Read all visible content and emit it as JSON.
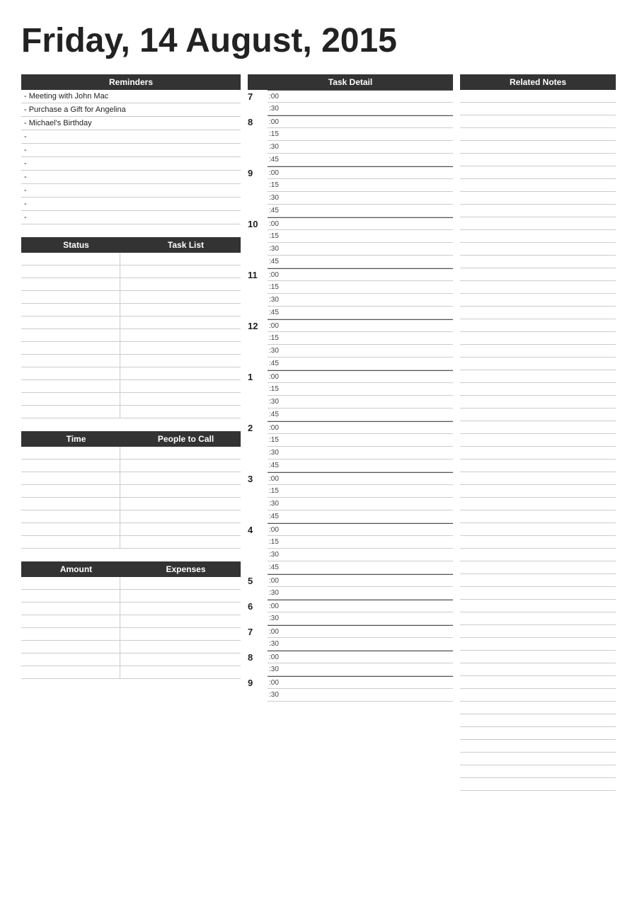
{
  "title": "Friday, 14 August, 2015",
  "reminders": {
    "header": "Reminders",
    "items": [
      "- Meeting with John Mac",
      "- Purchase a Gift for Angelina",
      "- Michael's Birthday",
      "-",
      "-",
      "-",
      "-",
      "-",
      "-",
      "-"
    ]
  },
  "tasklist": {
    "status_header": "Status",
    "task_header": "Task List",
    "rows": 13
  },
  "people_to_call": {
    "time_header": "Time",
    "people_header": "People to Call",
    "rows": 8
  },
  "expenses": {
    "amount_header": "Amount",
    "expenses_header": "Expenses",
    "rows": 8
  },
  "task_detail": {
    "header": "Task Detail",
    "hours": [
      {
        "num": "7",
        "slots": [
          ":00",
          ":30"
        ]
      },
      {
        "num": "8",
        "slots": [
          ":00",
          ":15",
          ":30",
          ":45"
        ]
      },
      {
        "num": "9",
        "slots": [
          ":00",
          ":15",
          ":30",
          ":45"
        ]
      },
      {
        "num": "10",
        "slots": [
          ":00",
          ":15",
          ":30",
          ":45"
        ]
      },
      {
        "num": "11",
        "slots": [
          ":00",
          ":15",
          ":30",
          ":45"
        ]
      },
      {
        "num": "12",
        "slots": [
          ":00",
          ":15",
          ":30",
          ":45"
        ]
      },
      {
        "num": "1",
        "slots": [
          ":00",
          ":15",
          ":30",
          ":45"
        ]
      },
      {
        "num": "2",
        "slots": [
          ":00",
          ":15",
          ":30",
          ":45"
        ]
      },
      {
        "num": "3",
        "slots": [
          ":00",
          ":15",
          ":30",
          ":45"
        ]
      },
      {
        "num": "4",
        "slots": [
          ":00",
          ":15",
          ":30",
          ":45"
        ]
      },
      {
        "num": "5",
        "slots": [
          ":00",
          ":30"
        ]
      },
      {
        "num": "6",
        "slots": [
          ":00",
          ":30"
        ]
      },
      {
        "num": "7",
        "slots": [
          ":00",
          ":30"
        ]
      },
      {
        "num": "8",
        "slots": [
          ":00",
          ":30"
        ]
      },
      {
        "num": "9",
        "slots": [
          ":00",
          ":30"
        ]
      }
    ]
  },
  "related_notes": {
    "header": "Related Notes",
    "rows": 55
  }
}
